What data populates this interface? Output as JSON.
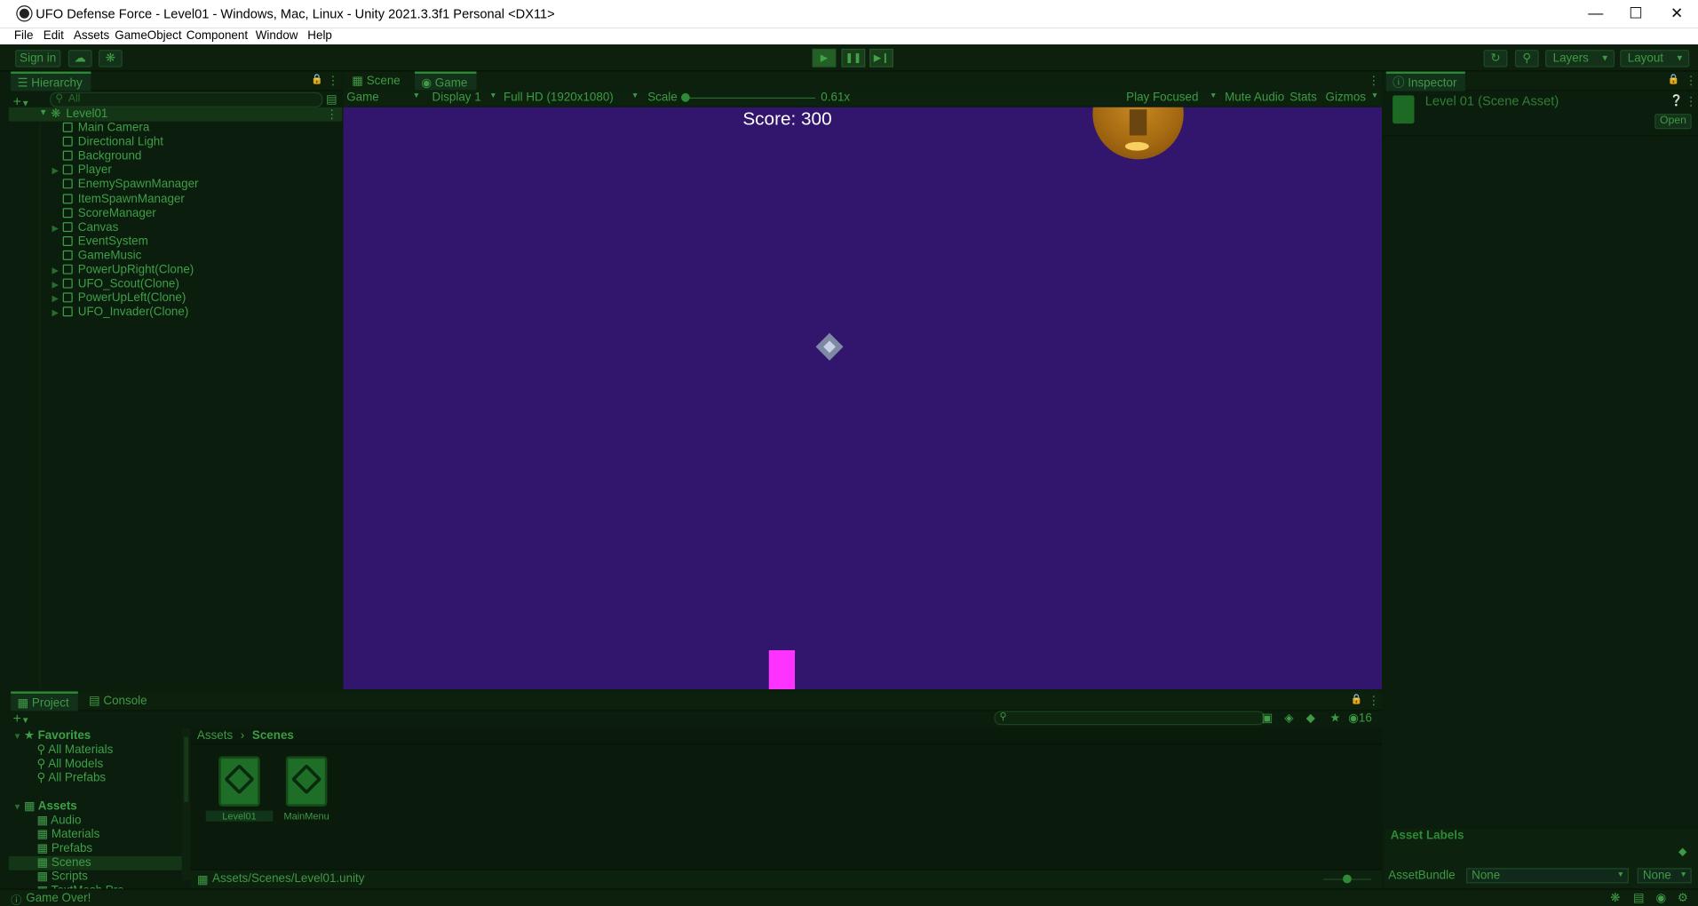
{
  "window": {
    "title": "UFO Defense Force - Level01 - Windows, Mac, Linux - Unity 2021.3.3f1 Personal <DX11>",
    "minimize_icon": "minimize-icon",
    "maximize_icon": "maximize-icon",
    "close_icon": "close-icon"
  },
  "menu": [
    "File",
    "Edit",
    "Assets",
    "GameObject",
    "Component",
    "Window",
    "Help"
  ],
  "toolbar": {
    "sign_in": "Sign in",
    "layers": "Layers",
    "layout": "Layout"
  },
  "hierarchy": {
    "tab_label": "Hierarchy",
    "search_placeholder": "All",
    "root": "Level01",
    "items": [
      {
        "label": "Main Camera",
        "expandable": false
      },
      {
        "label": "Directional Light",
        "expandable": false
      },
      {
        "label": "Background",
        "expandable": false
      },
      {
        "label": "Player",
        "expandable": true
      },
      {
        "label": "EnemySpawnManager",
        "expandable": false
      },
      {
        "label": "ItemSpawnManager",
        "expandable": false
      },
      {
        "label": "ScoreManager",
        "expandable": false
      },
      {
        "label": "Canvas",
        "expandable": true
      },
      {
        "label": "EventSystem",
        "expandable": false
      },
      {
        "label": "GameMusic",
        "expandable": false
      },
      {
        "label": "PowerUpRight(Clone)",
        "expandable": true
      },
      {
        "label": "UFO_Scout(Clone)",
        "expandable": true
      },
      {
        "label": "PowerUpLeft(Clone)",
        "expandable": true
      },
      {
        "label": "UFO_Invader(Clone)",
        "expandable": true
      }
    ]
  },
  "view_tabs": {
    "scene": "Scene",
    "game": "Game"
  },
  "game_toolbar": {
    "view_mode": "Game",
    "display": "Display 1",
    "resolution": "Full HD (1920x1080)",
    "scale_label": "Scale",
    "scale_value": "0.61x",
    "play_focused": "Play Focused",
    "mute_audio": "Mute Audio",
    "stats": "Stats",
    "gizmos": "Gizmos"
  },
  "game": {
    "score_text": "Score: 300",
    "background_color": "#32166e",
    "player_color": "#ff33ff"
  },
  "inspector": {
    "tab_label": "Inspector",
    "asset_title": "Level 01 (Scene Asset)",
    "open_button": "Open",
    "asset_labels": "Asset Labels",
    "assetbundle_label": "AssetBundle",
    "assetbundle_value": "None",
    "variant_value": "None"
  },
  "project": {
    "tab_project": "Project",
    "tab_console": "Console",
    "hidden_count": "16",
    "favorites_label": "Favorites",
    "favorites": [
      "All Materials",
      "All Models",
      "All Prefabs"
    ],
    "assets_label": "Assets",
    "folders": [
      "Audio",
      "Materials",
      "Prefabs",
      "Scenes",
      "Scripts",
      "TextMesh Pro"
    ],
    "breadcrumb": [
      "Assets",
      "Scenes"
    ],
    "files": [
      "Level01",
      "MainMenu"
    ],
    "selected_path": "Assets/Scenes/Level01.unity"
  },
  "status": {
    "message": "Game Over!"
  },
  "theme": {
    "accent": "#3f9a44",
    "panel": "#0b1d0c"
  }
}
